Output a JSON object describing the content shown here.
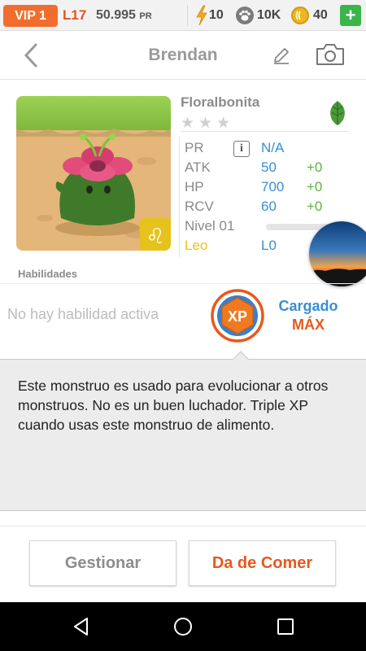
{
  "statusbar": {
    "vip": "VIP 1",
    "level": "L17",
    "pr_value": "50.995",
    "pr_unit": "PR",
    "energy": "10",
    "paws": "10K",
    "coins": "40",
    "plus": "+",
    "icons": {
      "energy": "lightning-icon",
      "paws": "paw-icon",
      "coins": "coin-icon"
    }
  },
  "header": {
    "title": "Brendan",
    "icons": {
      "back": "chevron-left-icon",
      "edit": "pencil-icon",
      "camera": "camera-icon"
    }
  },
  "monster": {
    "name": "Floralbonita",
    "stars_total": 3,
    "stars_filled": 0,
    "element_icon": "leaf-icon",
    "sign_icon": "leo-zodiac-icon",
    "stats": {
      "pr": {
        "label": "PR",
        "value": "N/A"
      },
      "atk": {
        "label": "ATK",
        "value": "50",
        "bonus": "+0"
      },
      "hp": {
        "label": "HP",
        "value": "700",
        "bonus": "+0"
      },
      "rcv": {
        "label": "RCV",
        "value": "60",
        "bonus": "+0"
      },
      "level": {
        "label": "Nivel 01"
      },
      "sign": {
        "label": "Leo",
        "value": "L0"
      }
    }
  },
  "abilities": {
    "label": "Habilidades",
    "none_text": "No hay habilidad activa",
    "xp_badge": "XP",
    "charged_label": "Cargado",
    "charged_value": "MÁX"
  },
  "description": {
    "text": "Este monstruo es usado para evolucionar a otros monstruos. No es un buen luchador. Triple XP  cuando usas este monstruo de alimento."
  },
  "buttons": {
    "manage": "Gestionar",
    "feed": "Da de Comer"
  },
  "colors": {
    "accent_orange": "#e8581c",
    "vip_orange": "#f26d2d",
    "stat_blue": "#3b8ed0",
    "bonus_green": "#5bb53b",
    "leo_yellow": "#e6c21c"
  }
}
